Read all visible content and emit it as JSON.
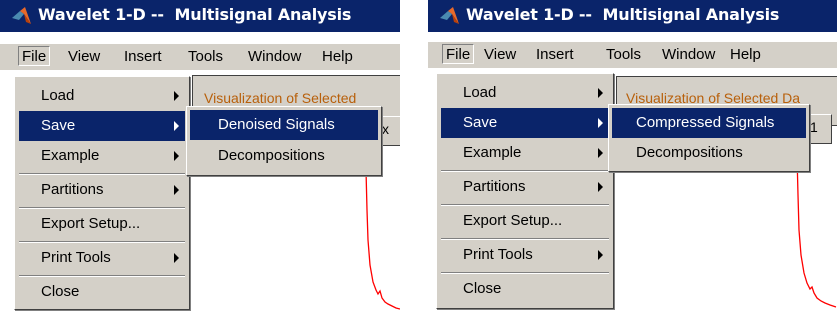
{
  "colors": {
    "titlebar": "#0a246a",
    "menu_bg": "#d4d0c8",
    "highlight": "#0a246a",
    "label": "#b8600b",
    "signal": "#ff0000"
  },
  "left": {
    "title": "Wavelet 1-D --  Multisignal Analysis",
    "menubar": [
      "File",
      "View",
      "Insert",
      "Tools",
      "Window",
      "Help"
    ],
    "figure_label": "Visualization of Selected",
    "figure_button": "x",
    "file_menu": [
      "Load",
      "Save",
      "Example",
      "Partitions",
      "Export Setup...",
      "Print Tools",
      "Close"
    ],
    "submenu": [
      "Denoised Signals",
      "Decompositions"
    ]
  },
  "right": {
    "title": "Wavelet 1-D --  Multisignal Analysis",
    "menubar": [
      "File",
      "View",
      "Insert",
      "Tools",
      "Window",
      "Help"
    ],
    "figure_label": "Visualization of Selected Da",
    "figure_button": "1",
    "file_menu": [
      "Load",
      "Save",
      "Example",
      "Partitions",
      "Export Setup...",
      "Print Tools",
      "Close"
    ],
    "submenu": [
      "Compressed Signals",
      "Decompositions"
    ]
  }
}
